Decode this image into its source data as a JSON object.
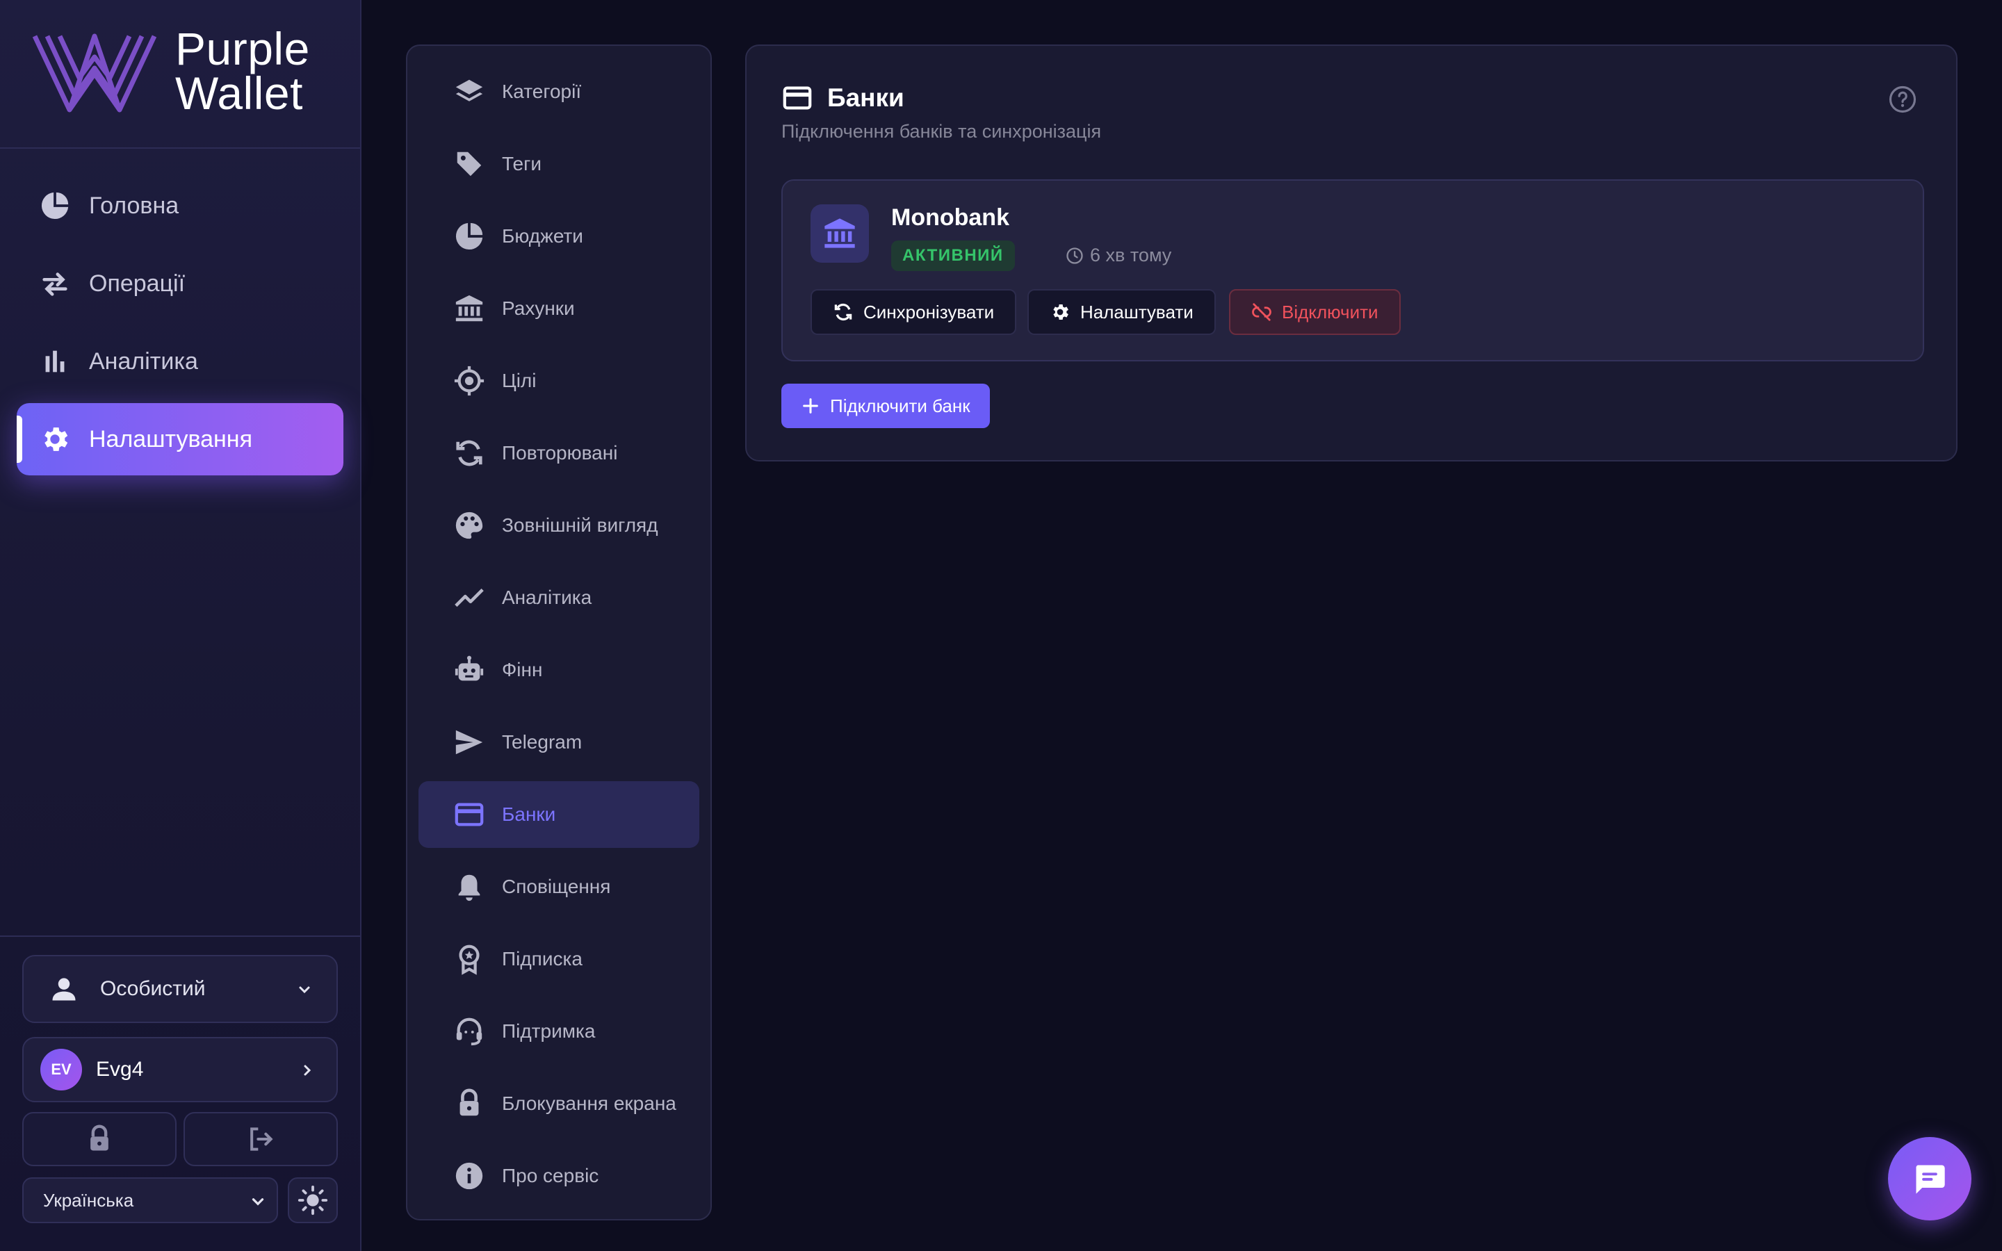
{
  "brand": {
    "line1": "Purple",
    "line2": "Wallet"
  },
  "main_nav": [
    {
      "label": "Головна",
      "icon": "pie-chart-icon"
    },
    {
      "label": "Операції",
      "icon": "swap-arrows-icon"
    },
    {
      "label": "Аналітика",
      "icon": "bar-chart-icon"
    },
    {
      "label": "Налаштування",
      "icon": "gear-icon",
      "active": true
    }
  ],
  "account": {
    "label": "Особистий"
  },
  "user": {
    "initials": "EV",
    "name": "Evg4"
  },
  "language": {
    "selected": "Українська"
  },
  "settings_menu": [
    {
      "label": "Категорії",
      "icon": "layers-icon"
    },
    {
      "label": "Теги",
      "icon": "tag-icon"
    },
    {
      "label": "Бюджети",
      "icon": "pie-chart-icon"
    },
    {
      "label": "Рахунки",
      "icon": "bank-icon"
    },
    {
      "label": "Цілі",
      "icon": "target-icon"
    },
    {
      "label": "Повторювані",
      "icon": "repeat-icon"
    },
    {
      "label": "Зовнішній вигляд",
      "icon": "palette-icon"
    },
    {
      "label": "Аналітика",
      "icon": "trend-line-icon"
    },
    {
      "label": "Фінн",
      "icon": "robot-icon"
    },
    {
      "label": "Telegram",
      "icon": "send-icon"
    },
    {
      "label": "Банки",
      "icon": "credit-card-icon",
      "active": true
    },
    {
      "label": "Сповіщення",
      "icon": "bell-icon"
    },
    {
      "label": "Підписка",
      "icon": "badge-icon"
    },
    {
      "label": "Підтримка",
      "icon": "headset-icon"
    },
    {
      "label": "Блокування екрана",
      "icon": "lock-icon"
    },
    {
      "label": "Про сервіс",
      "icon": "info-icon"
    }
  ],
  "panel": {
    "title": "Банки",
    "subtitle": "Підключення банків та синхронізація",
    "bank": {
      "name": "Monobank",
      "status": "АКТИВНИЙ",
      "last_sync": "6 хв тому",
      "actions": {
        "sync": "Синхронізувати",
        "configure": "Налаштувати",
        "disconnect": "Відключити"
      }
    },
    "connect_label": "Підключити банк"
  },
  "colors": {
    "accent": "#6a5cf6",
    "accent_gradient_end": "#a35ef0",
    "status_active": "#35c46a",
    "danger": "#f0525c",
    "background": "#0d0d1f"
  }
}
